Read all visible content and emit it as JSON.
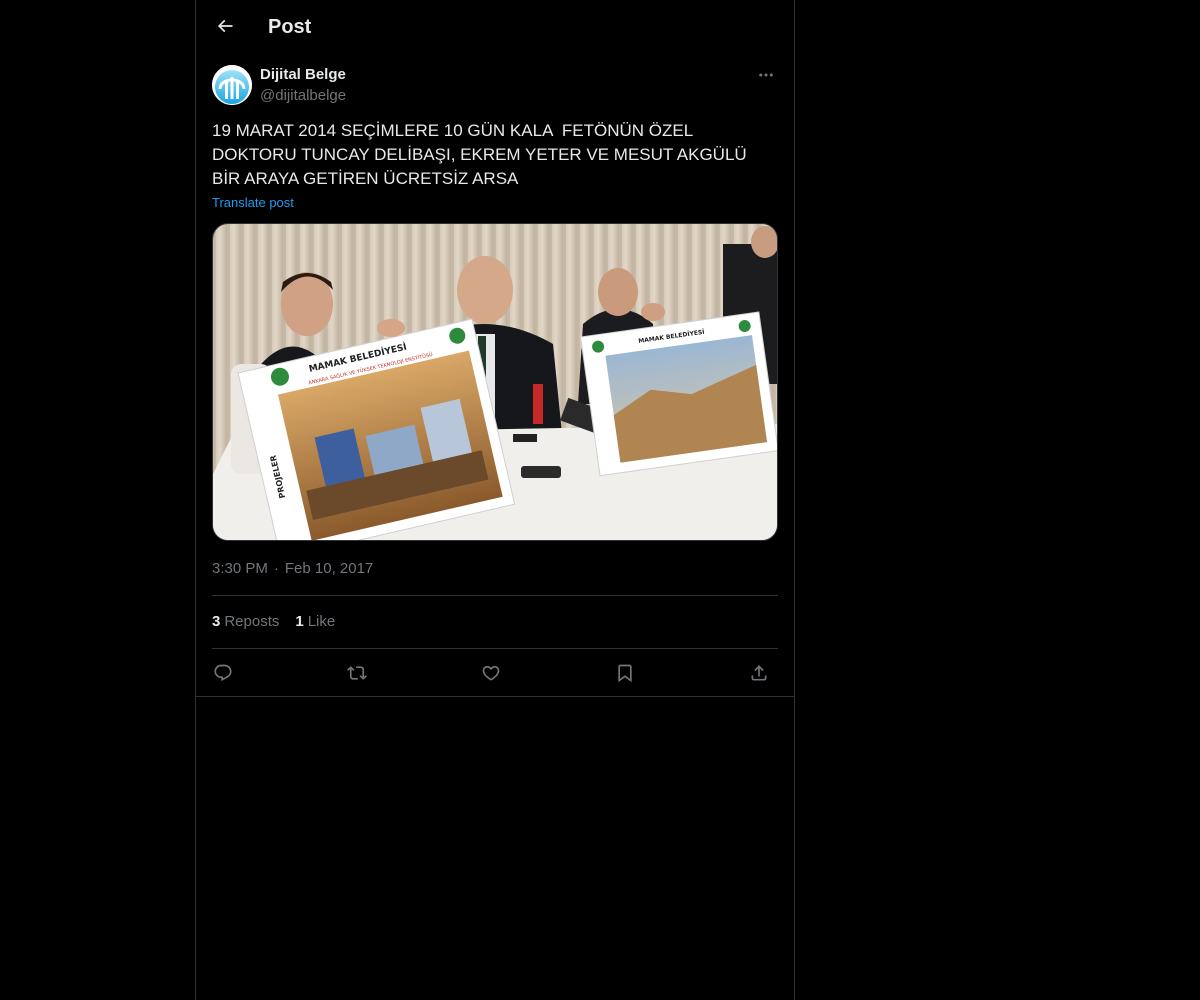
{
  "header": {
    "title": "Post",
    "back_icon": "arrow-left-icon"
  },
  "author": {
    "name": "Dijital Belge",
    "handle": "@dijitalbelge",
    "more_icon": "more-horizontal-icon"
  },
  "post": {
    "text": "19 MARAT 2014 SEÇİMLERE 10 GÜN KALA  FETÖNÜN ÖZEL DOKTORU TUNCAY DELİBAŞI, EKREM YETER VE MESUT AKGÜLÜ BİR ARAYA GETİREN ÜCRETSİZ ARSA",
    "translate_label": "Translate post",
    "image": {
      "sign_left_title": "MAMAK BELEDİYESİ",
      "sign_left_subtitle": "ANKARA SAĞLIK VE YÜKSEK TEKNOLOJİ ENSTİTÜSÜ",
      "sign_left_side": "PROJELER",
      "sign_right_title": "MAMAK BELEDİYESİ"
    }
  },
  "meta": {
    "time": "3:30 PM",
    "separator": "·",
    "date": "Feb 10, 2017"
  },
  "stats": {
    "reposts_count": "3",
    "reposts_label": "Reposts",
    "likes_count": "1",
    "likes_label": "Like"
  },
  "actions": [
    "reply-icon",
    "repost-icon",
    "like-icon",
    "bookmark-icon",
    "share-icon"
  ],
  "colors": {
    "background": "#000000",
    "text_primary": "#e7e9ea",
    "text_secondary": "#71767b",
    "accent": "#1d9bf0",
    "border": "#2f3336"
  }
}
